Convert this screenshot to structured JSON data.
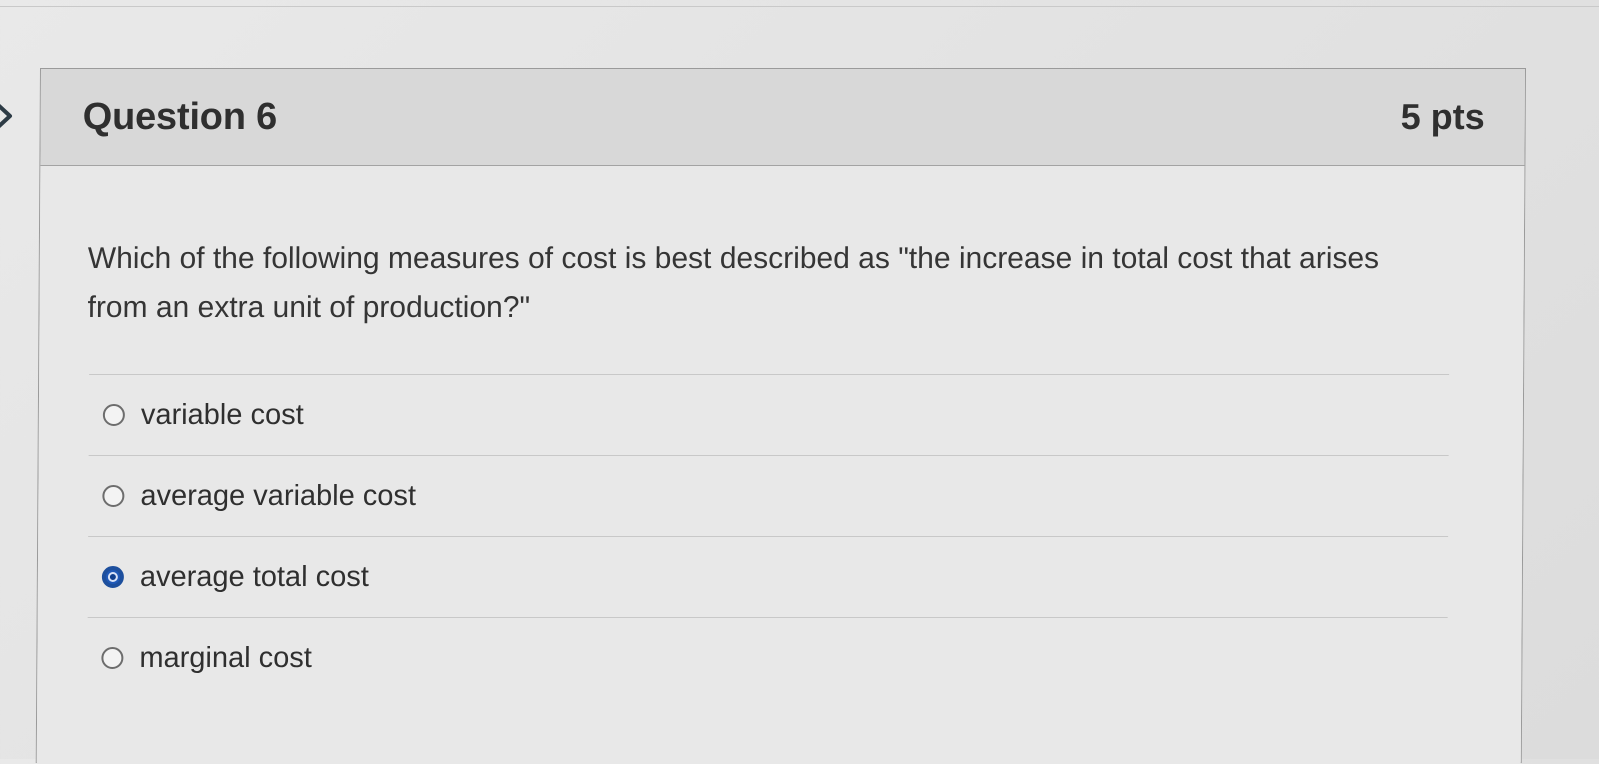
{
  "question": {
    "title": "Question 6",
    "points": "5 pts",
    "prompt": "Which of the following measures of cost is best described as \"the increase in total cost that arises from an extra unit of production?\""
  },
  "answers": [
    {
      "label": "variable cost",
      "selected": false
    },
    {
      "label": "average variable cost",
      "selected": false
    },
    {
      "label": "average total cost",
      "selected": true
    },
    {
      "label": "marginal cost",
      "selected": false
    }
  ],
  "icons": {
    "navigation": "chevron-right-icon",
    "radio_unselected": "radio-button-unchecked",
    "radio_selected": "radio-button-checked"
  },
  "colors": {
    "selected_radio": "#1f59b8",
    "text_primary": "#2f2f2f",
    "header_background": "#d8d8d8",
    "body_background": "#e8e8e8"
  }
}
